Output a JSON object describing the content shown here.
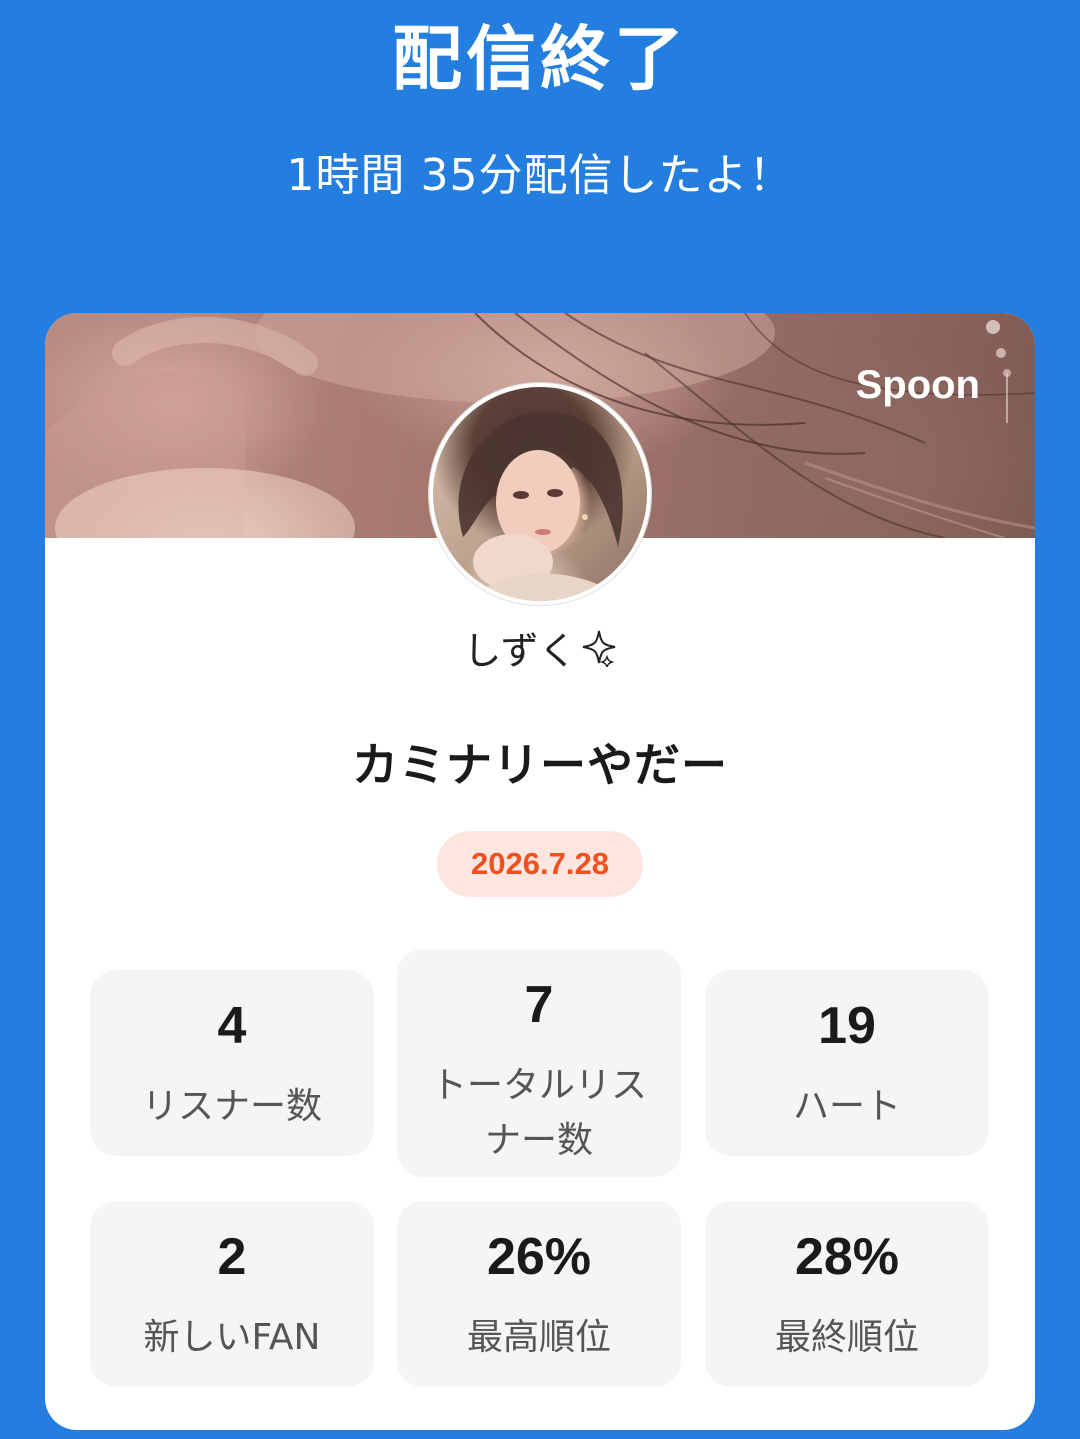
{
  "header": {
    "title": "配信終了",
    "duration_text": "1時間 35分配信したよ！"
  },
  "card": {
    "brand_label": "Spoon",
    "user_name": "しずく",
    "user_name_suffix_icon": "sparkle-icon",
    "broadcast_title": "カミナリーやだー",
    "date": "2026.7.28"
  },
  "stats": [
    {
      "value": "4",
      "label": "リスナー数"
    },
    {
      "value": "7",
      "label_line1": "トータルリス",
      "label_line2": "ナー数"
    },
    {
      "value": "19",
      "label": "ハート"
    },
    {
      "value": "2",
      "label": "新しいFAN"
    },
    {
      "value": "26%",
      "label": "最高順位"
    },
    {
      "value": "28%",
      "label": "最終順位"
    }
  ],
  "colors": {
    "background": "#247ee0",
    "date_text": "#f0501e",
    "date_badge": "#fde6df",
    "stat_box": "#f5f5f5"
  }
}
